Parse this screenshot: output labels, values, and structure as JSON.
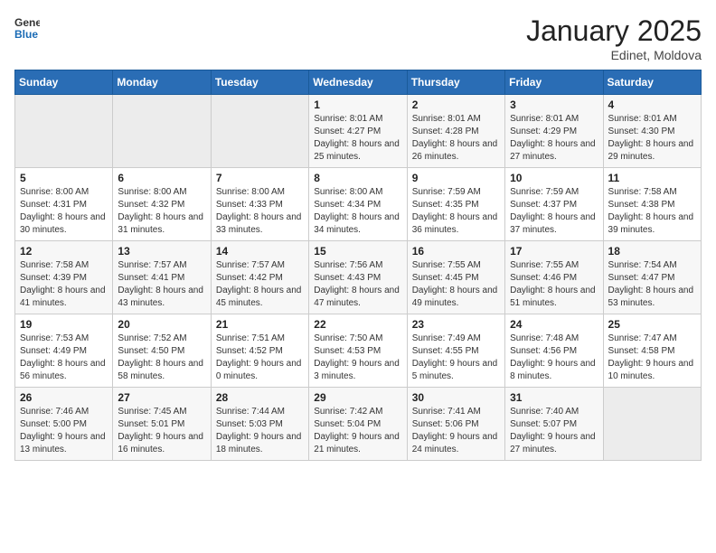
{
  "header": {
    "logo_general": "General",
    "logo_blue": "Blue",
    "month": "January 2025",
    "location": "Edinet, Moldova"
  },
  "weekdays": [
    "Sunday",
    "Monday",
    "Tuesday",
    "Wednesday",
    "Thursday",
    "Friday",
    "Saturday"
  ],
  "weeks": [
    [
      {
        "day": "",
        "info": ""
      },
      {
        "day": "",
        "info": ""
      },
      {
        "day": "",
        "info": ""
      },
      {
        "day": "1",
        "info": "Sunrise: 8:01 AM\nSunset: 4:27 PM\nDaylight: 8 hours and 25 minutes."
      },
      {
        "day": "2",
        "info": "Sunrise: 8:01 AM\nSunset: 4:28 PM\nDaylight: 8 hours and 26 minutes."
      },
      {
        "day": "3",
        "info": "Sunrise: 8:01 AM\nSunset: 4:29 PM\nDaylight: 8 hours and 27 minutes."
      },
      {
        "day": "4",
        "info": "Sunrise: 8:01 AM\nSunset: 4:30 PM\nDaylight: 8 hours and 29 minutes."
      }
    ],
    [
      {
        "day": "5",
        "info": "Sunrise: 8:00 AM\nSunset: 4:31 PM\nDaylight: 8 hours and 30 minutes."
      },
      {
        "day": "6",
        "info": "Sunrise: 8:00 AM\nSunset: 4:32 PM\nDaylight: 8 hours and 31 minutes."
      },
      {
        "day": "7",
        "info": "Sunrise: 8:00 AM\nSunset: 4:33 PM\nDaylight: 8 hours and 33 minutes."
      },
      {
        "day": "8",
        "info": "Sunrise: 8:00 AM\nSunset: 4:34 PM\nDaylight: 8 hours and 34 minutes."
      },
      {
        "day": "9",
        "info": "Sunrise: 7:59 AM\nSunset: 4:35 PM\nDaylight: 8 hours and 36 minutes."
      },
      {
        "day": "10",
        "info": "Sunrise: 7:59 AM\nSunset: 4:37 PM\nDaylight: 8 hours and 37 minutes."
      },
      {
        "day": "11",
        "info": "Sunrise: 7:58 AM\nSunset: 4:38 PM\nDaylight: 8 hours and 39 minutes."
      }
    ],
    [
      {
        "day": "12",
        "info": "Sunrise: 7:58 AM\nSunset: 4:39 PM\nDaylight: 8 hours and 41 minutes."
      },
      {
        "day": "13",
        "info": "Sunrise: 7:57 AM\nSunset: 4:41 PM\nDaylight: 8 hours and 43 minutes."
      },
      {
        "day": "14",
        "info": "Sunrise: 7:57 AM\nSunset: 4:42 PM\nDaylight: 8 hours and 45 minutes."
      },
      {
        "day": "15",
        "info": "Sunrise: 7:56 AM\nSunset: 4:43 PM\nDaylight: 8 hours and 47 minutes."
      },
      {
        "day": "16",
        "info": "Sunrise: 7:55 AM\nSunset: 4:45 PM\nDaylight: 8 hours and 49 minutes."
      },
      {
        "day": "17",
        "info": "Sunrise: 7:55 AM\nSunset: 4:46 PM\nDaylight: 8 hours and 51 minutes."
      },
      {
        "day": "18",
        "info": "Sunrise: 7:54 AM\nSunset: 4:47 PM\nDaylight: 8 hours and 53 minutes."
      }
    ],
    [
      {
        "day": "19",
        "info": "Sunrise: 7:53 AM\nSunset: 4:49 PM\nDaylight: 8 hours and 56 minutes."
      },
      {
        "day": "20",
        "info": "Sunrise: 7:52 AM\nSunset: 4:50 PM\nDaylight: 8 hours and 58 minutes."
      },
      {
        "day": "21",
        "info": "Sunrise: 7:51 AM\nSunset: 4:52 PM\nDaylight: 9 hours and 0 minutes."
      },
      {
        "day": "22",
        "info": "Sunrise: 7:50 AM\nSunset: 4:53 PM\nDaylight: 9 hours and 3 minutes."
      },
      {
        "day": "23",
        "info": "Sunrise: 7:49 AM\nSunset: 4:55 PM\nDaylight: 9 hours and 5 minutes."
      },
      {
        "day": "24",
        "info": "Sunrise: 7:48 AM\nSunset: 4:56 PM\nDaylight: 9 hours and 8 minutes."
      },
      {
        "day": "25",
        "info": "Sunrise: 7:47 AM\nSunset: 4:58 PM\nDaylight: 9 hours and 10 minutes."
      }
    ],
    [
      {
        "day": "26",
        "info": "Sunrise: 7:46 AM\nSunset: 5:00 PM\nDaylight: 9 hours and 13 minutes."
      },
      {
        "day": "27",
        "info": "Sunrise: 7:45 AM\nSunset: 5:01 PM\nDaylight: 9 hours and 16 minutes."
      },
      {
        "day": "28",
        "info": "Sunrise: 7:44 AM\nSunset: 5:03 PM\nDaylight: 9 hours and 18 minutes."
      },
      {
        "day": "29",
        "info": "Sunrise: 7:42 AM\nSunset: 5:04 PM\nDaylight: 9 hours and 21 minutes."
      },
      {
        "day": "30",
        "info": "Sunrise: 7:41 AM\nSunset: 5:06 PM\nDaylight: 9 hours and 24 minutes."
      },
      {
        "day": "31",
        "info": "Sunrise: 7:40 AM\nSunset: 5:07 PM\nDaylight: 9 hours and 27 minutes."
      },
      {
        "day": "",
        "info": ""
      }
    ]
  ]
}
